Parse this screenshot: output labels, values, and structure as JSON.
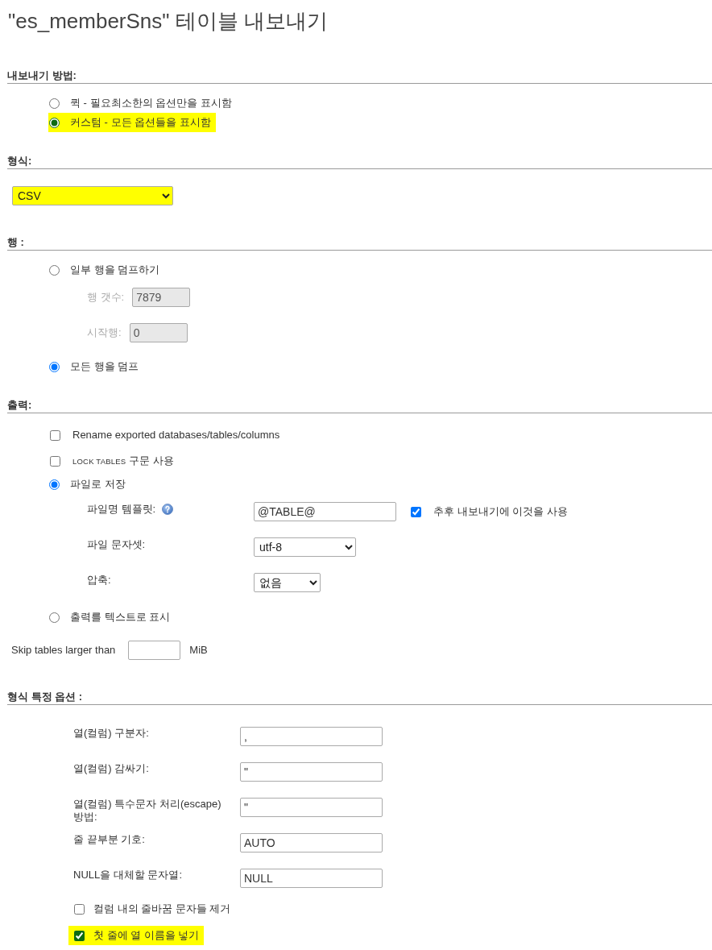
{
  "title": "\"es_memberSns\" 테이블 내보내기",
  "export_method": {
    "heading": "내보내기 방법:",
    "options": [
      {
        "label": "퀵 - 필요최소한의 옵션만을 표시함",
        "selected": false,
        "highlighted": false
      },
      {
        "label": "커스텀 - 모든 옵션들을 표시함",
        "selected": true,
        "highlighted": true
      }
    ]
  },
  "format": {
    "heading": "형식:",
    "select": {
      "value": "CSV",
      "highlighted": true
    }
  },
  "rows": {
    "heading": "행 :",
    "options": [
      {
        "label": "일부 행을 덤프하기",
        "selected": false,
        "fields": [
          {
            "label": "행 갯수:",
            "value": "7879",
            "disabled": true
          },
          {
            "label": "시작행:",
            "value": "0",
            "disabled": true
          }
        ]
      },
      {
        "label": "모든 행을 덤프",
        "selected": true
      }
    ]
  },
  "output": {
    "heading": "출력:",
    "items": [
      {
        "kind": "checkbox",
        "label": "Rename exported databases/tables/columns",
        "checked": false
      },
      {
        "kind": "checkbox",
        "keyword": "LOCK TABLES",
        "label": "구문 사용",
        "checked": false
      },
      {
        "kind": "radio",
        "label": "파일로 저장",
        "selected": true,
        "settings": [
          {
            "kind": "text",
            "label": "파일명 템플릿:",
            "help": true,
            "value": "@TABLE@",
            "remember": {
              "label": "추후 내보내기에 이것을 사용",
              "checked": true
            }
          },
          {
            "kind": "select",
            "label": "파일 문자셋:",
            "value": "utf-8"
          },
          {
            "kind": "select",
            "label": "압축:",
            "value": "없음"
          }
        ]
      },
      {
        "kind": "radio",
        "label": "출력를 텍스트로 표시",
        "selected": false
      }
    ],
    "skip": {
      "label": "Skip tables larger than",
      "unit": "MiB"
    }
  },
  "format_options": {
    "heading": "형식 특정 옵션 :",
    "fields": [
      {
        "label": "열(컬럼) 구분자:",
        "value": ","
      },
      {
        "label": "열(컬럼) 감싸기:",
        "value": "\""
      },
      {
        "label": "열(컬럼) 특수문자 처리(escape) 방법:",
        "value": "\""
      },
      {
        "label": "줄 끝부분 기호:",
        "value": "AUTO"
      },
      {
        "label": "NULL을 대체할 문자열:",
        "value": "NULL"
      }
    ],
    "checkboxes": [
      {
        "label": "컬럼 내의 줄바꿈 문자들 제거",
        "checked": false,
        "highlighted": false
      },
      {
        "label": "첫 줄에 열 이름을 넣기",
        "checked": true,
        "highlighted": true
      }
    ]
  }
}
